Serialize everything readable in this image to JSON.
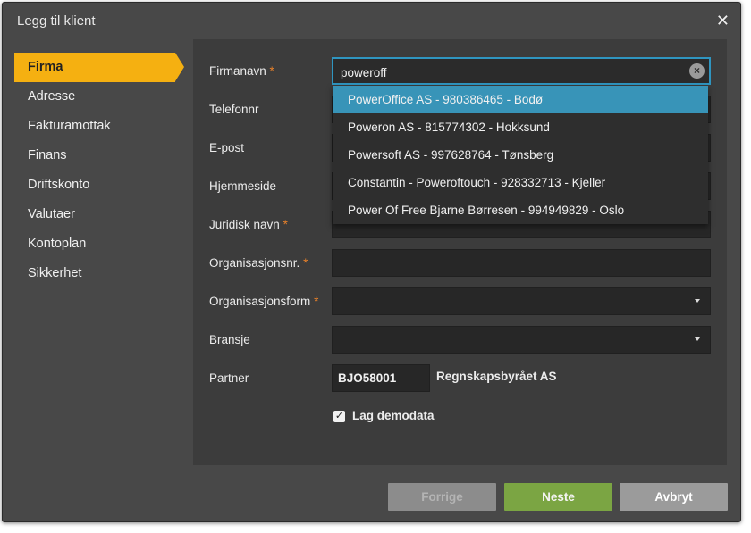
{
  "dialog": {
    "title": "Legg til klient",
    "close_glyph": "✕"
  },
  "sidebar": {
    "items": [
      {
        "label": "Firma",
        "active": true
      },
      {
        "label": "Adresse"
      },
      {
        "label": "Fakturamottak"
      },
      {
        "label": "Finans"
      },
      {
        "label": "Driftskonto"
      },
      {
        "label": "Valutaer"
      },
      {
        "label": "Kontoplan"
      },
      {
        "label": "Sikkerhet"
      }
    ]
  },
  "form": {
    "required_mark": "*",
    "firmanavn": {
      "label": "Firmanavn",
      "value": "poweroff",
      "clear_glyph": "×"
    },
    "telefonnr": {
      "label": "Telefonnr",
      "value": ""
    },
    "epost": {
      "label": "E-post",
      "value": ""
    },
    "hjemmeside": {
      "label": "Hjemmeside",
      "value": ""
    },
    "juridisk_navn": {
      "label": "Juridisk navn",
      "value": ""
    },
    "organisasjonsnr": {
      "label": "Organisasjonsnr.",
      "value": ""
    },
    "organisasjonsform": {
      "label": "Organisasjonsform",
      "value": ""
    },
    "bransje": {
      "label": "Bransje",
      "value": ""
    },
    "partner": {
      "label": "Partner",
      "code": "BJO58001",
      "name": "Regnskapsbyrået AS"
    },
    "demodata": {
      "label": "Lag demodata",
      "checked": true,
      "check_glyph": "✓"
    }
  },
  "autocomplete": {
    "suggestions": [
      "PowerOffice AS - 980386465 - Bodø",
      "Poweron AS - 815774302 - Hokksund",
      "Powersoft AS - 997628764 - Tønsberg",
      "Constantin - Poweroftouch - 928332713 - Kjeller",
      "Power Of Free Bjarne Børresen - 994949829 - Oslo"
    ],
    "highlighted_index": 0
  },
  "footer": {
    "prev_label": "Forrige",
    "next_label": "Neste",
    "cancel_label": "Avbryt"
  },
  "colors": {
    "accent": "#f5b011",
    "highlight": "#3894b8",
    "next_button": "#7ba543",
    "required": "#e8812a"
  }
}
